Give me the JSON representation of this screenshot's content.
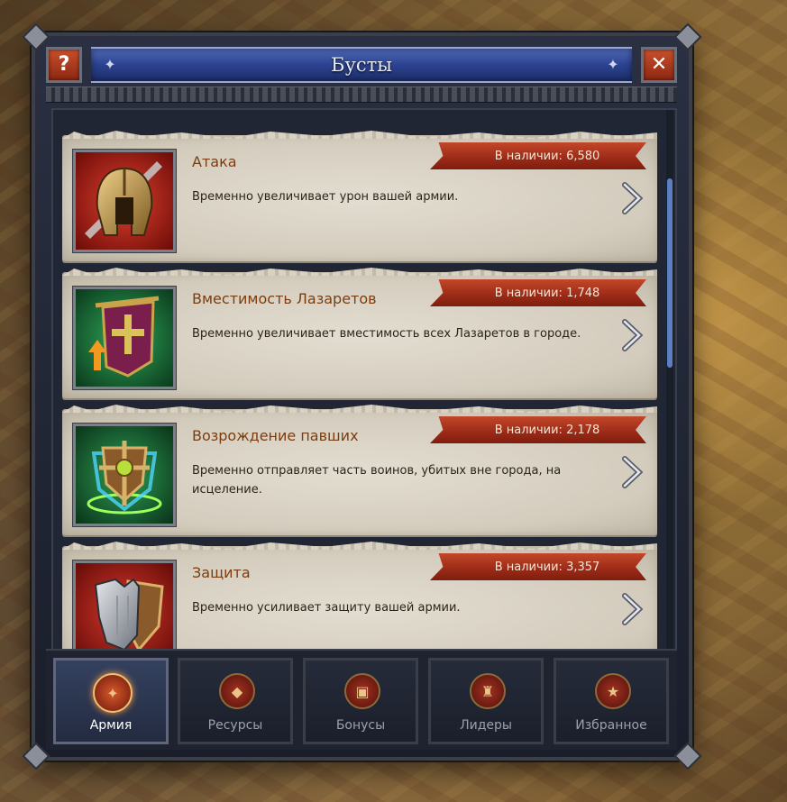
{
  "dialog": {
    "title": "Бусты",
    "help_label": "?",
    "close_label": "✕"
  },
  "boosts": [
    {
      "title": "Атака",
      "availability": "В наличии: 6,580",
      "description": "Временно увеличивает урон вашей армии.",
      "icon": "helmet-icon"
    },
    {
      "title": "Вместимость Лазаретов",
      "availability": "В наличии: 1,748",
      "description": "Временно увеличивает вместимость всех Лазаретов в городе.",
      "icon": "banner-icon"
    },
    {
      "title": "Возрождение павших",
      "availability": "В наличии: 2,178",
      "description": "Временно отправляет часть воинов, убитых вне города, на исцеление.",
      "icon": "revive-shield-icon"
    },
    {
      "title": "Защита",
      "availability": "В наличии: 3,357",
      "description": "Временно усиливает защиту вашей армии.",
      "icon": "armor-icon"
    }
  ],
  "tabs": [
    {
      "label": "Армия",
      "icon": "army-icon",
      "active": true
    },
    {
      "label": "Ресурсы",
      "icon": "resources-icon",
      "active": false
    },
    {
      "label": "Бонусы",
      "icon": "bonuses-icon",
      "active": false
    },
    {
      "label": "Лидеры",
      "icon": "leaders-icon",
      "active": false
    },
    {
      "label": "Избранное",
      "icon": "favorites-icon",
      "active": false
    }
  ],
  "colors": {
    "title_banner": "#2c4290",
    "availability_banner": "#9a2a17",
    "card_title": "#7b3d10",
    "active_tab_icon": "#d65a2b"
  }
}
